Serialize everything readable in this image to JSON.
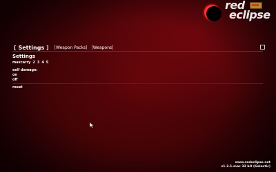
{
  "logo": {
    "line1": "red",
    "line2": "eclipse"
  },
  "tabs": [
    {
      "label": "Settings",
      "active": true
    },
    {
      "label": "Weapon Packs",
      "active": false
    },
    {
      "label": "Weapons",
      "active": false
    }
  ],
  "panel": {
    "title": "Settings",
    "maxcarry": {
      "label": "maxcarry",
      "options": [
        "2",
        "3",
        "4",
        "5"
      ]
    },
    "self_damage": {
      "label": "self damage:",
      "options": [
        "on",
        "off"
      ]
    },
    "reset_label": "reset"
  },
  "footer": {
    "url": "www.redeclipse.net",
    "version": "v1.3.1-mac 32 bit (Galactic)"
  },
  "colors": {
    "background": "#4a0408",
    "divider": "#7a2a2e",
    "text": "#ffffff"
  },
  "icons": {
    "window": "square-icon",
    "cursor": "mouse-pointer-icon"
  }
}
